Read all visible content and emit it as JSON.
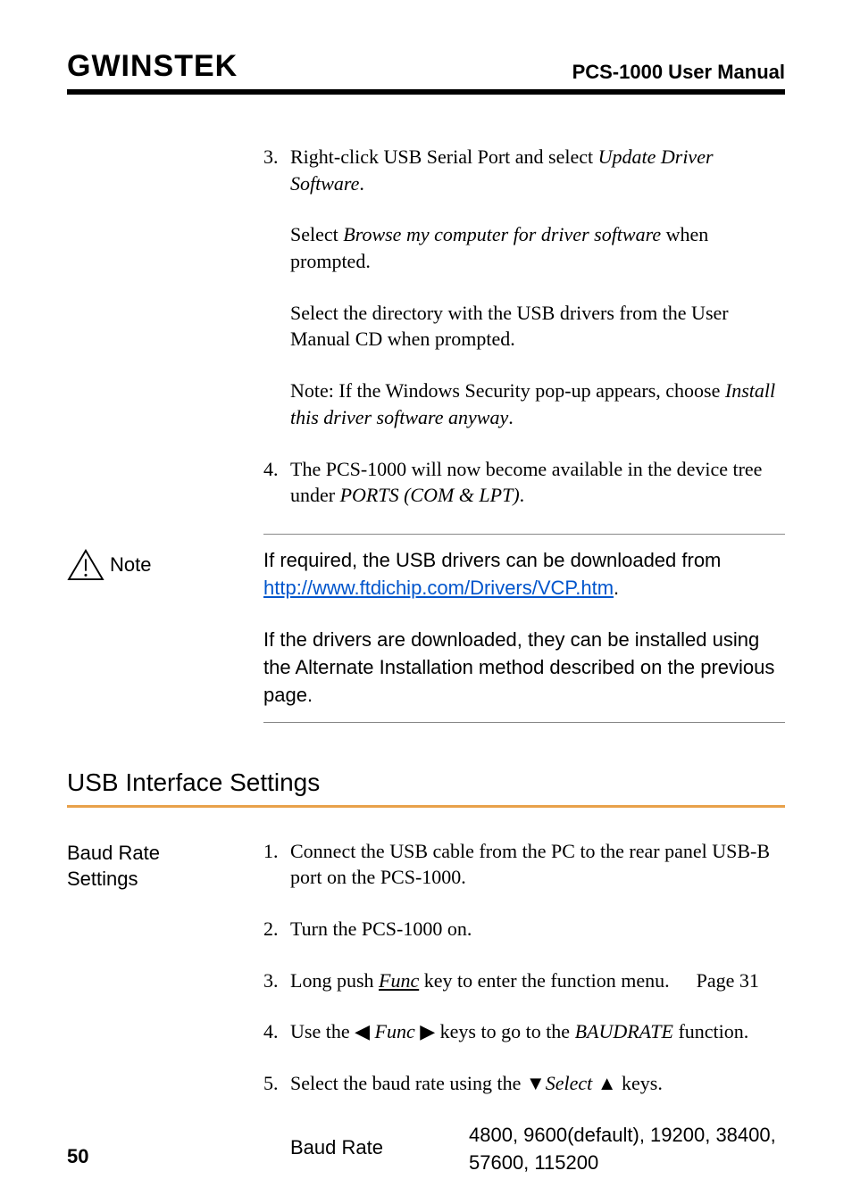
{
  "header": {
    "logo_text": "GWINSTEK",
    "manual_title": "PCS-1000 User Manual"
  },
  "steps_top": [
    {
      "num": "3.",
      "paras": [
        {
          "parts": [
            {
              "t": "Right-click USB Serial Port and select "
            },
            {
              "t": "Update Driver Software",
              "italic": true
            },
            {
              "t": "."
            }
          ]
        },
        {
          "parts": [
            {
              "t": "Select "
            },
            {
              "t": "Browse my computer for driver software",
              "italic": true
            },
            {
              "t": " when prompted."
            }
          ]
        },
        {
          "parts": [
            {
              "t": "Select the directory with the USB drivers from the User Manual CD when prompted."
            }
          ]
        },
        {
          "parts": [
            {
              "t": "Note: If the Windows Security pop-up appears, choose "
            },
            {
              "t": "Install this driver software anyway",
              "italic": true
            },
            {
              "t": "."
            }
          ]
        }
      ]
    },
    {
      "num": "4.",
      "paras": [
        {
          "parts": [
            {
              "t": "The PCS-1000 will now become available in the device tree under "
            },
            {
              "t": "PORTS (COM & LPT)",
              "italic": true
            },
            {
              "t": "."
            }
          ]
        }
      ]
    }
  ],
  "note": {
    "label": "Note",
    "paras": [
      {
        "parts": [
          {
            "t": "If required, the USB drivers can be downloaded from "
          },
          {
            "t": "http://www.ftdichip.com/Drivers/VCP.htm",
            "link": true
          },
          {
            "t": "."
          }
        ]
      },
      {
        "parts": [
          {
            "t": "If the drivers are downloaded, they can be installed using the Alternate Installation method described on the previous page."
          }
        ]
      }
    ]
  },
  "section_heading": "USB Interface Settings",
  "settings": {
    "label_line1": "Baud Rate",
    "label_line2": "Settings",
    "steps": [
      {
        "num": "1.",
        "parts": [
          {
            "t": "Connect the USB cable from the PC to the rear panel USB-B port on the PCS-1000."
          }
        ]
      },
      {
        "num": "2.",
        "parts": [
          {
            "t": "Turn the PCS-1000 on."
          }
        ]
      },
      {
        "num": "3.",
        "parts": [
          {
            "t": "Long push "
          },
          {
            "t": "Func",
            "under_ital": true
          },
          {
            "t": " key to enter the function menu."
          }
        ],
        "page_ref": "Page 31"
      },
      {
        "num": "4.",
        "parts": [
          {
            "t": "Use the ◀ "
          },
          {
            "t": "Func",
            "italic": true
          },
          {
            "t": " ▶ keys to go to the "
          },
          {
            "t": "BAUDRATE",
            "italic": true
          },
          {
            "t": " function."
          }
        ]
      },
      {
        "num": "5.",
        "parts": [
          {
            "t": "Select the baud rate using the ▼"
          },
          {
            "t": "Select",
            "italic": true
          },
          {
            "t": " ▲ keys."
          }
        ],
        "baud_table": {
          "label": "Baud Rate",
          "values": "4800, 9600(default), 19200, 38400, 57600, 115200"
        }
      }
    ]
  },
  "page_number": "50"
}
